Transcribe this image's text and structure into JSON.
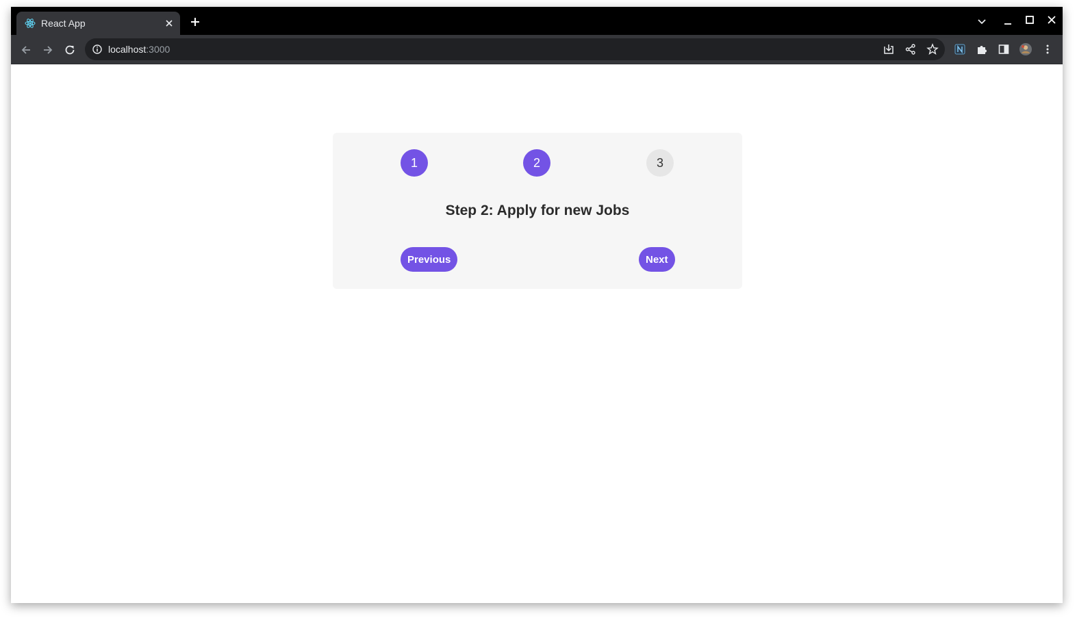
{
  "browser": {
    "tab_title": "React App",
    "url_host": "localhost",
    "url_port": ":3000",
    "icons": {
      "favicon": "react-logo-icon",
      "tab_close": "close-icon",
      "new_tab": "plus-icon",
      "tab_search": "chevron-down-icon",
      "minimize": "minimize-icon",
      "maximize": "maximize-icon",
      "close_window": "close-icon",
      "back": "arrow-left-icon",
      "forward": "arrow-right-icon",
      "reload": "reload-icon",
      "site_info": "info-icon",
      "install": "install-icon",
      "share": "share-icon",
      "bookmark": "star-icon",
      "extension": "extension-n-icon",
      "extensions": "puzzle-icon",
      "side_panel": "side-panel-icon",
      "profile": "avatar-icon",
      "menu": "kebab-menu-icon"
    }
  },
  "page": {
    "steps": [
      {
        "label": "1",
        "state": "completed"
      },
      {
        "label": "2",
        "state": "current"
      },
      {
        "label": "3",
        "state": "upcoming"
      }
    ],
    "step_title": "Step 2: Apply for new Jobs",
    "previous_label": "Previous",
    "next_label": "Next",
    "colors": {
      "accent": "#7353e5",
      "card_bg": "#f6f6f6",
      "inactive_step": "#e6e6e6"
    }
  }
}
